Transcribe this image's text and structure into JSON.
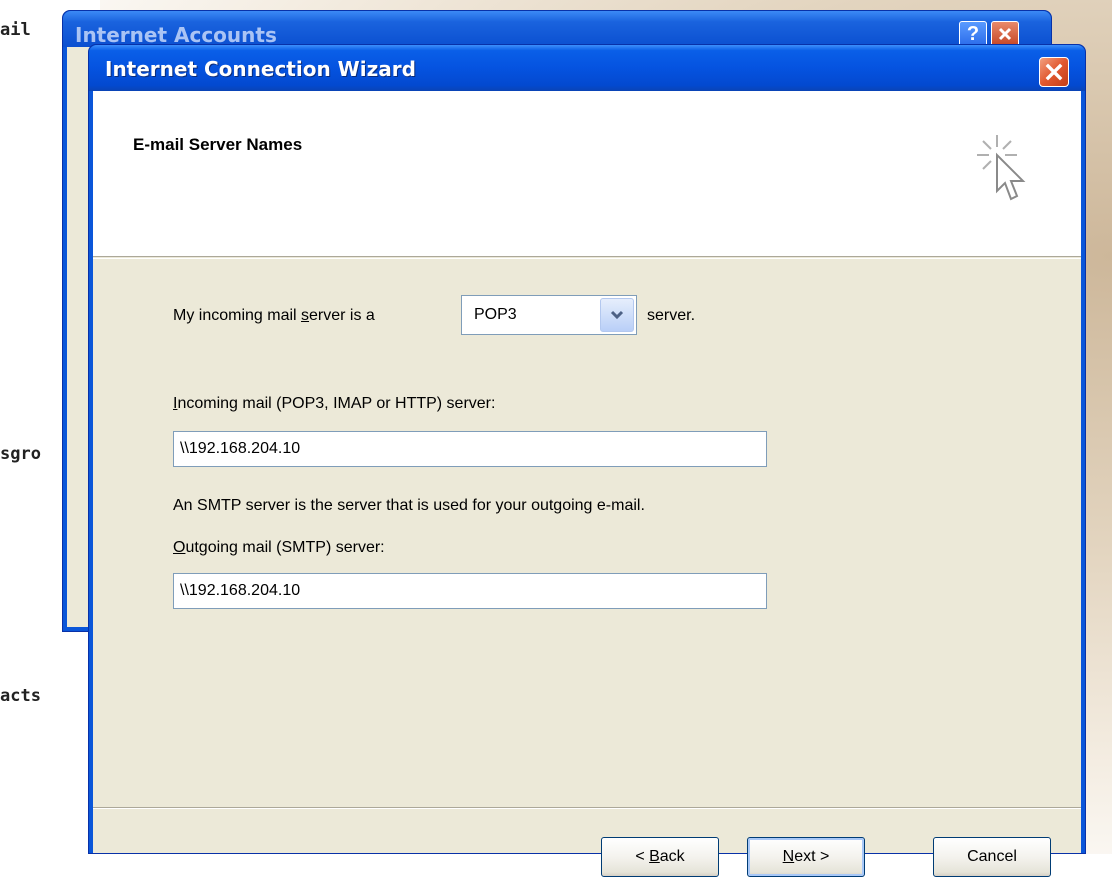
{
  "side_labels": [
    "ail",
    "sgro",
    "acts"
  ],
  "background_window": {
    "title": "Internet Accounts",
    "help_label": "?"
  },
  "wizard": {
    "title": "Internet Connection Wizard",
    "heading": "E-mail Server Names",
    "incoming_prefix_before": "My incoming mail ",
    "incoming_prefix_u": "s",
    "incoming_prefix_after": "erver is a",
    "server_type_value": "POP3",
    "server_suffix": "server.",
    "incoming_field_label_u": "I",
    "incoming_field_label_rest": "ncoming mail (POP3, IMAP or HTTP) server:",
    "incoming_server": "\\\\192.168.204.10",
    "smtp_note": "An SMTP server is the server that is used for your outgoing e-mail.",
    "outgoing_field_label_u": "O",
    "outgoing_field_label_rest": "utgoing mail (SMTP) server:",
    "outgoing_server": "\\\\192.168.204.10",
    "buttons": {
      "back_before": "< ",
      "back_u": "B",
      "back_after": "ack",
      "next_u": "N",
      "next_after": "ext >",
      "cancel": "Cancel"
    }
  },
  "colors": {
    "titlebar": "#0553e0",
    "client_bg": "#ece9d8",
    "close_red": "#e1582f"
  }
}
